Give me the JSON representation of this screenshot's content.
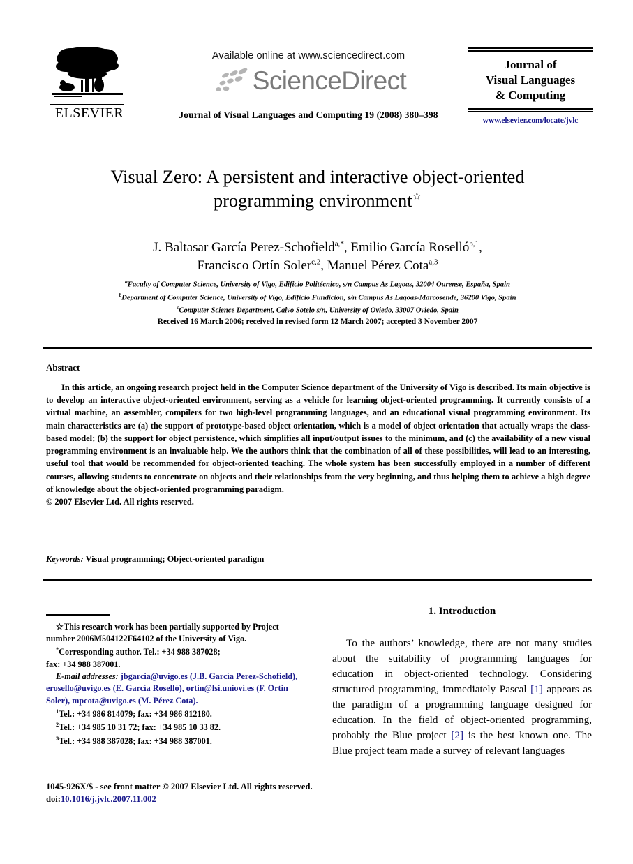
{
  "masthead": {
    "publisher_name": "ELSEVIER",
    "available_online": "Available online at www.sciencedirect.com",
    "sciencedirect_wordmark": "ScienceDirect",
    "journal_reference": "Journal of Visual Languages and Computing 19 (2008) 380–398",
    "journal_box_title": "Journal of\nVisual Languages\n& Computing",
    "journal_box_line1": "Journal of",
    "journal_box_line2": "Visual Languages",
    "journal_box_line3": "& Computing",
    "journal_url": "www.elsevier.com/locate/jvlc"
  },
  "article": {
    "title_line1": "Visual Zero: A persistent and interactive object-oriented",
    "title_line2": "programming environment",
    "title_star": "☆",
    "authors_line1": "J. Baltasar García Perez-Schofield",
    "authors_line1_sup": "a,*",
    "authors_line1_cont": ", Emilio García Roselló",
    "authors_line1_sup2": "b,1",
    "authors_line1_end": ",",
    "authors_line2": "Francisco Ortín Soler",
    "authors_line2_sup": "c,2",
    "authors_line2_cont": ", Manuel Pérez Cota",
    "authors_line2_sup2": "a,3",
    "affiliation_a_sup": "a",
    "affiliation_a": "Faculty of Computer Science, University of Vigo, Edificio Politécnico, s/n Campus As Lagoas, 32004 Ourense, España, Spain",
    "affiliation_b_sup": "b",
    "affiliation_b": "Department of Computer Science, University of Vigo, Edificio Fundición, s/n Campus As Lagoas-Marcosende, 36200 Vigo, Spain",
    "affiliation_c_sup": "c",
    "affiliation_c": "Computer Science Department, Calvo Sotelo s/n, University of Oviedo, 33007 Oviedo, Spain",
    "received_line": "Received 16 March 2006; received in revised form 12 March 2007; accepted 3 November 2007"
  },
  "abstract": {
    "heading": "Abstract",
    "paragraph": "In this article, an ongoing research project held in the Computer Science department of the University of Vigo is described. Its main objective is to develop an interactive object-oriented environment, serving as a vehicle for learning object-oriented programming. It currently consists of a virtual machine, an assembler, compilers for two high-level programming languages, and an educational visual programming environment. Its main characteristics are (a) the support of prototype-based object orientation, which is a model of object orientation that actually wraps the class-based model; (b) the support for object persistence, which simplifies all input/output issues to the minimum, and (c) the availability of a new visual programming environment is an invaluable help. We the authors think that the combination of all of these possibilities, will lead to an interesting, useful tool that would be recommended for object-oriented teaching. The whole system has been successfully employed in a number of different courses, allowing students to concentrate on objects and their relationships from the very beginning, and thus helping them to achieve a high degree of knowledge about the object-oriented programming paradigm.",
    "copyright": "© 2007 Elsevier Ltd. All rights reserved.",
    "keywords_label": "Keywords:",
    "keywords_value": "Visual programming; Object-oriented paradigm"
  },
  "footnotes": {
    "star_marker": "☆",
    "star_text": "This research work has been partially supported by Project number 2006M504122F64102 of the University of Vigo.",
    "corresponding_marker": "*",
    "corresponding_text": "Corresponding author. Tel.: +34 988 387028;",
    "corresponding_fax": "fax: +34 988 387001.",
    "email_label": "E-mail addresses:",
    "email_1": "jbgarcia@uvigo.es",
    "email_1_owner": "(J.B. García Perez-Schofield),",
    "email_2": "erosello@uvigo.es",
    "email_2_owner": "(E. García Roselló),",
    "email_3": "ortin@lsi.uniovi.es",
    "email_3_owner": "(F. Ortin Soler),",
    "email_4": "mpcota@uvigo.es",
    "email_4_owner": "(M. Pérez Cota).",
    "note_1_sup": "1",
    "note_1": "Tel.: +34 986 814079; fax: +34 986 812180.",
    "note_2_sup": "2",
    "note_2": "Tel.: +34 985 10 31 72; fax: +34 985 10 33 82.",
    "note_3_sup": "3",
    "note_3": "Tel.: +34 988 387028; fax: +34 988 387001."
  },
  "introduction": {
    "heading": "1.  Introduction",
    "paragraph_part1": "To the authors’ knowledge, there are not many studies about the suitability of programming languages for education in object-oriented technology. Considering structured programming, immediately Pascal ",
    "ref1": "[1]",
    "paragraph_part2": " appears as the paradigm of a programming language designed for education. In the field of object-oriented programming, probably the Blue project ",
    "ref2": "[2]",
    "paragraph_part3": " is the best known one. The Blue project team made a survey of relevant languages"
  },
  "page_footer": {
    "issn_line": "1045-926X/$ - see front matter © 2007 Elsevier Ltd. All rights reserved.",
    "doi_label": "doi:",
    "doi_value": "10.1016/j.jvlc.2007.11.002"
  },
  "colors": {
    "link_blue": "#1a1a8c",
    "sciencedirect_gray": "#7a7a7a",
    "text_black": "#000000"
  }
}
